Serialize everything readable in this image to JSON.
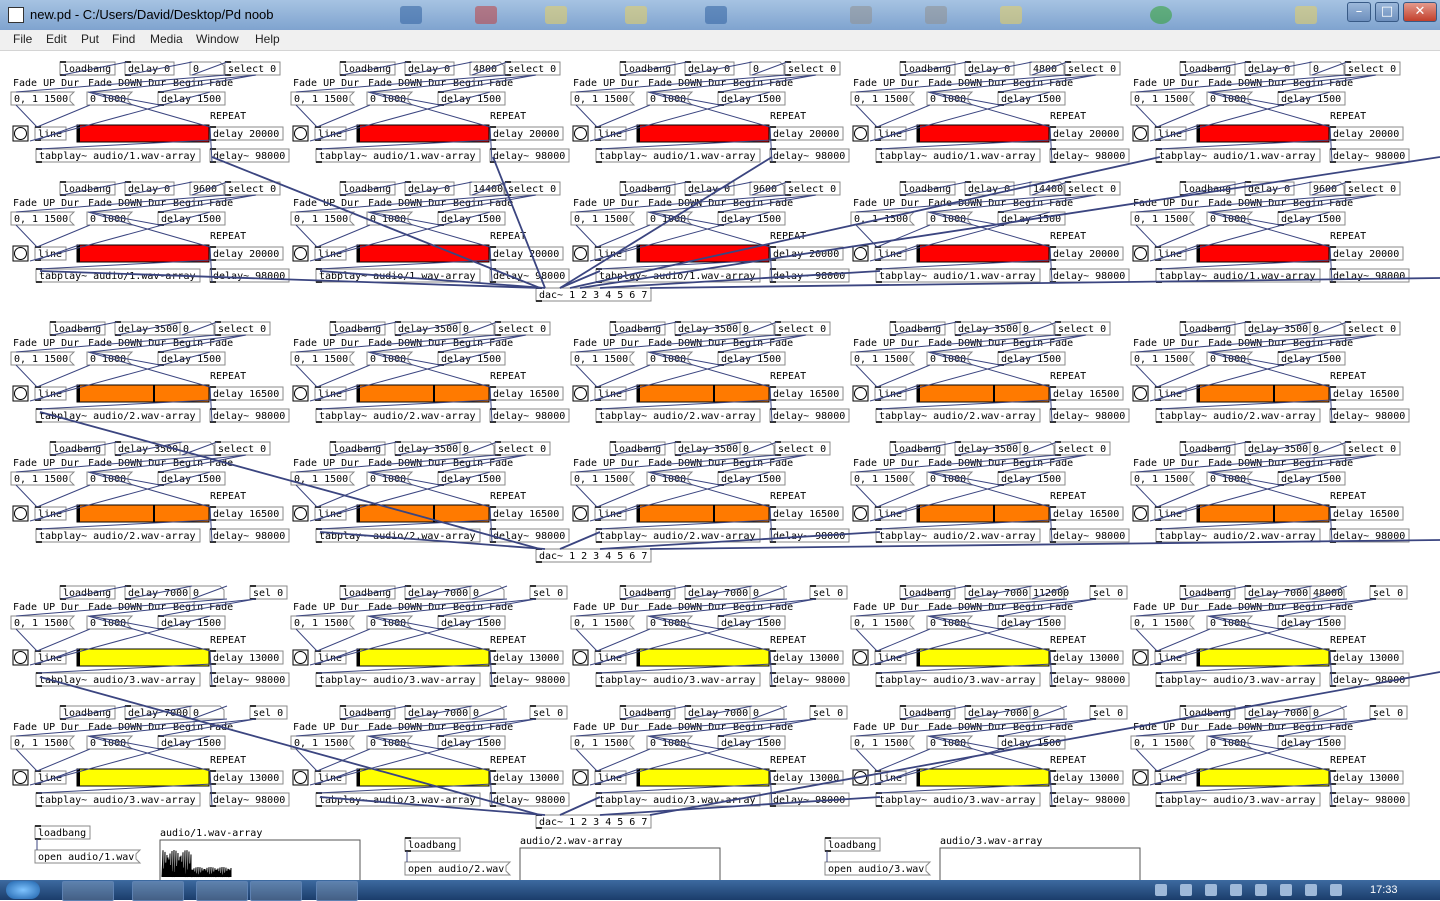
{
  "window": {
    "title": "new.pd  - C:/Users/David/Desktop/Pd noob",
    "buttons": [
      "–",
      "□",
      "✕"
    ]
  },
  "menu": [
    "File",
    "Edit",
    "Put",
    "Find",
    "Media",
    "Window",
    "Help"
  ],
  "patch": {
    "labels": {
      "loadbang": "loadbang",
      "delay0": "delay 0",
      "delay3500": "delay 3500",
      "delay7000": "delay 7000",
      "select0": "select 0",
      "sel0": "sel 0",
      "fade_up": "Fade UP Dur",
      "fade_down": "Fade DOWN Dur",
      "begin_fade": "Begin Fade",
      "msg_up": "0, 1 1500",
      "msg_down": "0 1000",
      "delay1500": "delay 1500",
      "repeat": "REPEAT",
      "line": "line",
      "delay98000": "delay~ 98000",
      "dac": "dac~ 1 2 3 4 5 6 7",
      "zero": "0"
    },
    "rows": [
      {
        "color": "#ff0000",
        "file": "tabplay~ audio/1.wav-array",
        "delay": "delay 20000",
        "starts": [
          "0",
          "4800",
          "0",
          "4800",
          "0"
        ],
        "cut": false
      },
      {
        "color": "#ff0000",
        "file": "tabplay~ audio/1.wav-array",
        "delay": "delay 20000",
        "starts": [
          "9600",
          "14400",
          "9600",
          "14400",
          "9600"
        ],
        "cut": false
      },
      {
        "color": "#ff7a00",
        "file": "tabplay~ audio/2.wav-array",
        "delay": "delay 16500",
        "starts": [],
        "cut": true
      },
      {
        "color": "#ff7a00",
        "file": "tabplay~ audio/2.wav-array",
        "delay": "delay 16500",
        "starts": [],
        "cut": true
      },
      {
        "color": "#ffff00",
        "file": "tabplay~ audio/3.wav-array",
        "delay": "delay 13000",
        "starts": [
          "0",
          "0",
          "0",
          "112000",
          "48000"
        ],
        "cut": false
      },
      {
        "color": "#ffff00",
        "file": "tabplay~ audio/3.wav-array",
        "delay": "delay 13000",
        "starts": [
          "0",
          "0",
          "0",
          "0",
          "0"
        ],
        "cut": false
      }
    ],
    "arrays": [
      {
        "loadbang": "loadbang",
        "open": "open audio/1.wav",
        "name": "audio/1.wav-array"
      },
      {
        "loadbang": "loadbang",
        "open": "open audio/2.wav",
        "name": "audio/2.wav-array"
      },
      {
        "loadbang": "loadbang",
        "open": "open audio/3.wav",
        "name": "audio/3.wav-array"
      }
    ]
  },
  "taskbar": {
    "time": "17:33"
  },
  "colors": {
    "connection": "#3b4580",
    "box_border": "#8a8a8a"
  }
}
